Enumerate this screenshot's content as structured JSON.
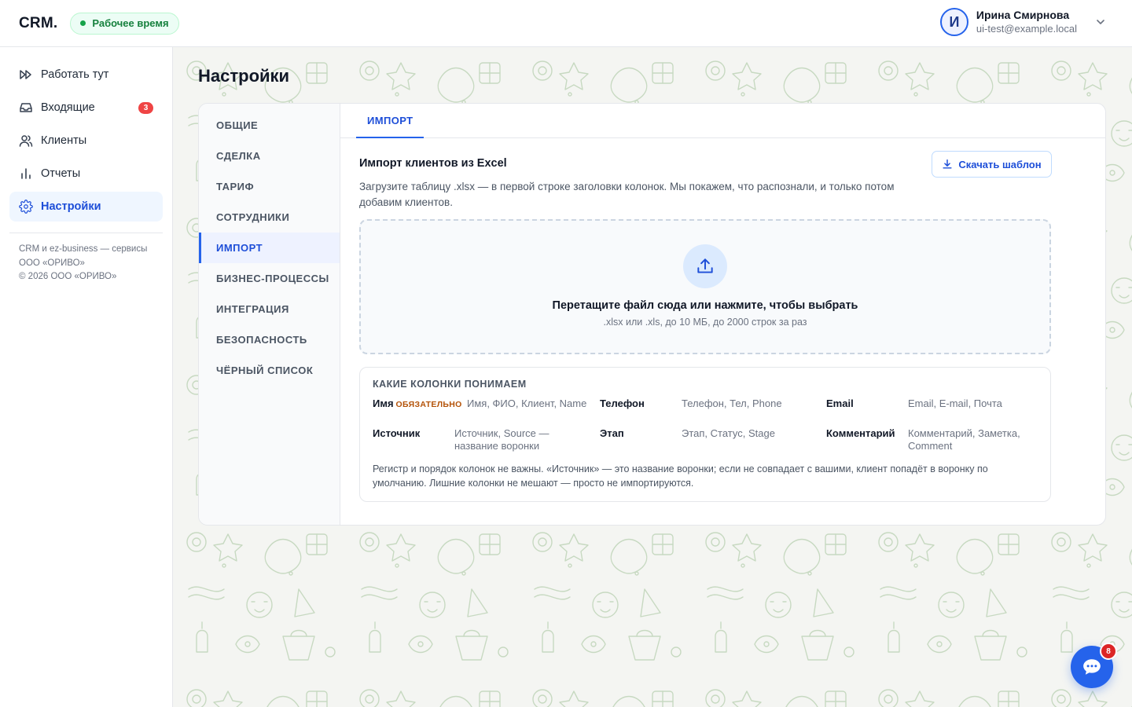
{
  "app": {
    "logo": "CRM.",
    "work_status": "Рабочее время",
    "user": {
      "initial": "И",
      "name": "Ирина Смирнова",
      "email": "ui-test@example.local"
    }
  },
  "sidebar": {
    "items": [
      {
        "label": "Работать тут",
        "icon": "fast-forward-icon"
      },
      {
        "label": "Входящие",
        "icon": "inbox-icon",
        "badge": "3"
      },
      {
        "label": "Клиенты",
        "icon": "users-icon"
      },
      {
        "label": "Отчеты",
        "icon": "bar-chart-icon"
      },
      {
        "label": "Настройки",
        "icon": "gear-icon",
        "active": true
      }
    ],
    "footer": [
      "CRM и ez-business — сервисы",
      "ООО «ОРИВО»",
      "© 2026 ООО «ОРИВО»"
    ]
  },
  "page": {
    "title": "Настройки",
    "settings_nav": [
      "ОБЩИЕ",
      "СДЕЛКА",
      "ТАРИФ",
      "СОТРУДНИКИ",
      "ИМПОРТ",
      "БИЗНЕС-ПРОЦЕССЫ",
      "ИНТЕГРАЦИЯ",
      "БЕЗОПАСНОСТЬ",
      "ЧЁРНЫЙ СПИСОК"
    ],
    "active_settings": "ИМПОРТ",
    "tab": "ИМПОРТ"
  },
  "import": {
    "title": "Импорт клиентов из Excel",
    "description": "Загрузите таблицу .xlsx — в первой строке заголовки колонок. Мы покажем, что распознали, и только потом добавим клиентов.",
    "template_button": "Скачать шаблон",
    "dropzone": {
      "title": "Перетащите файл сюда или нажмите, чтобы выбрать",
      "subtitle": ".xlsx или .xls, до 10 МБ, до 2000 строк за раз"
    },
    "columns": {
      "heading": "КАКИЕ КОЛОНКИ ПОНИМАЕМ",
      "required_label": "ОБЯЗАТЕЛЬНО",
      "items": [
        {
          "name": "Имя",
          "aliases": "Имя, ФИО, Клиент, Name"
        },
        {
          "name": "Телефон",
          "aliases": "Телефон, Тел, Phone"
        },
        {
          "name": "Email",
          "aliases": "Email, E-mail, Почта"
        },
        {
          "name": "Источник",
          "aliases": "Источник, Source — название воронки"
        },
        {
          "name": "Этап",
          "aliases": "Этап, Статус, Stage"
        },
        {
          "name": "Комментарий",
          "aliases": "Комментарий, Заметка, Comment"
        }
      ],
      "note": "Регистр и порядок колонок не важны. «Источник» — это название воронки; если не совпадает с вашими, клиент попадёт в воронку по умолчанию. Лишние колонки не мешают — просто не импортируются."
    }
  },
  "chat": {
    "badge": "8"
  },
  "colors": {
    "accent": "#2563eb",
    "badge": "#ef4444",
    "status_green": "#16a34a",
    "required": "#b45309"
  }
}
